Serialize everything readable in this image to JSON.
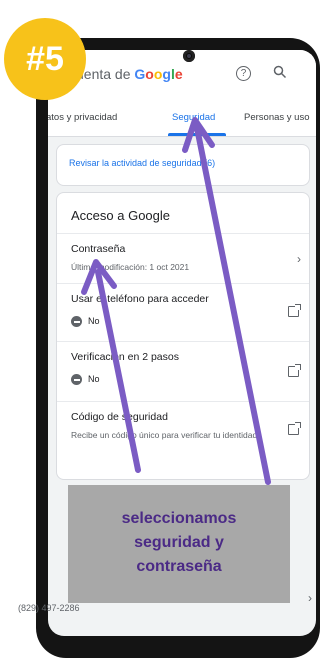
{
  "badge": {
    "text": "#5"
  },
  "app_bar": {
    "title_prefix": "uenta de ",
    "title_brand": "Google",
    "brand_colors": [
      "#4285f4",
      "#ea4335",
      "#fbbc05",
      "#4285f4",
      "#34a853",
      "#ea4335"
    ],
    "help_glyph": "?",
    "icons": [
      "help-icon",
      "search-icon"
    ]
  },
  "tabs": [
    {
      "label": "atos y privacidad",
      "active": false
    },
    {
      "label": "Seguridad",
      "active": true
    },
    {
      "label": "Personas y uso",
      "active": false
    }
  ],
  "review_link": "Revisar la actividad de seguridad (6)",
  "section": {
    "title": "Acceso a Google",
    "rows": [
      {
        "title": "Contraseña",
        "subtitle": "Última modificación: 1 oct 2021",
        "icon": "chevron-right-icon"
      },
      {
        "title": "Usar el teléfono para acceder",
        "status": "No",
        "icon": "external-link-icon"
      },
      {
        "title": "Verificación en 2 pasos",
        "status": "No",
        "icon": "external-link-icon"
      },
      {
        "title": "Código de seguridad",
        "subtitle": "Recibe un código único para verificar tu identidad",
        "icon": "external-link-icon"
      }
    ]
  },
  "recovery_phone": "(829) 497-2286",
  "annotation": {
    "lines": [
      "seleccionamos",
      "seguridad y",
      "contraseña"
    ],
    "text_color": "#4b2a86",
    "arrow_color": "#7b5cc4"
  },
  "colors": {
    "accent": "#1a73e8",
    "badge": "#f7c21a",
    "phone_frame": "#141414"
  }
}
